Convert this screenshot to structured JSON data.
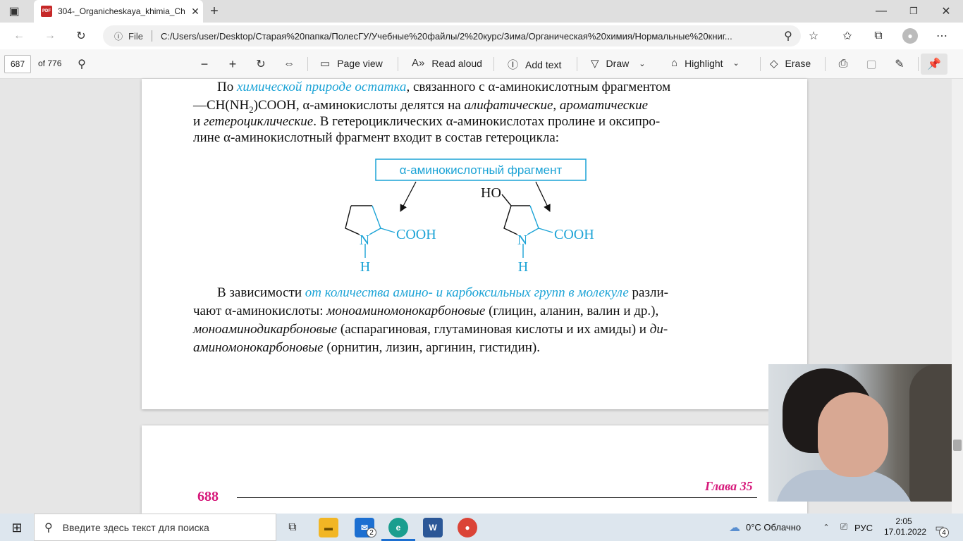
{
  "browser": {
    "tab_title": "304-_Organicheskaya_khimia_Ch",
    "tab_close": "✕",
    "new_tab": "+",
    "file_label": "File",
    "url": "C:/Users/user/Desktop/Старая%20папка/ПолесГУ/Учебные%20файлы/2%20курс/Зима/Органическая%20химия/Нормальные%20книг..."
  },
  "pdf_toolbar": {
    "page_number": "687",
    "page_count": "of 776",
    "page_view": "Page view",
    "read_aloud": "Read aloud",
    "add_text": "Add text",
    "draw": "Draw",
    "highlight": "Highlight",
    "erase": "Erase"
  },
  "content": {
    "p1": {
      "s1": "По ",
      "b1": "химической природе остатка",
      "s2": ", связанного с α-аминокислотным фрагментом",
      "s3": "—CH(NH",
      "sub": "2",
      "s4": ")COOH, α-аминокислоты делятся на ",
      "i1": "алифатические",
      "s5": ", ",
      "i2": "ароматические",
      "s6": "и ",
      "i3": "гетероциклические",
      "s7": ". В гетероциклических α-аминокислотах пролине и оксипро-",
      "s8": "лине α-аминокислотный фрагмент входит в состав гетероцикла:"
    },
    "figure": {
      "box_label": "α-аминокислотный фрагмент",
      "ho": "HO",
      "cooh_1": "COOH",
      "cooh_2": "COOH",
      "n_1": "N",
      "h_1": "H",
      "n_2": "N",
      "h_2": "H",
      "blue": "#1ba3d6"
    },
    "p2": {
      "s1": "В зависимости ",
      "b1": "от количества амино- и карбоксильных групп в молекуле",
      "s2": " разли-",
      "s3": "чают α-аминокислоты: ",
      "i1": "моноаминомонокарбоновые",
      "s4": " (глицин, аланин, валин и др.),",
      "i2": "моноаминодикарбоновые",
      "s5": " (аспарагиновая, глутаминовая кислоты и их амиды) и ",
      "i3": "ди-",
      "i4": "аминомонокарбоновые",
      "s6": " (орнитин, лизин, аргинин, гистидин)."
    },
    "next_page": {
      "page_num": "688",
      "chapter": "Глава 35",
      "accent": "#d6187a"
    }
  },
  "taskbar": {
    "search_placeholder": "Введите здесь текст для поиска",
    "mail_badge": "2",
    "weather": "0°C  Облачно",
    "lang": "РУС",
    "time": "2:05",
    "date": "17.01.2022",
    "notif_count": "4"
  }
}
